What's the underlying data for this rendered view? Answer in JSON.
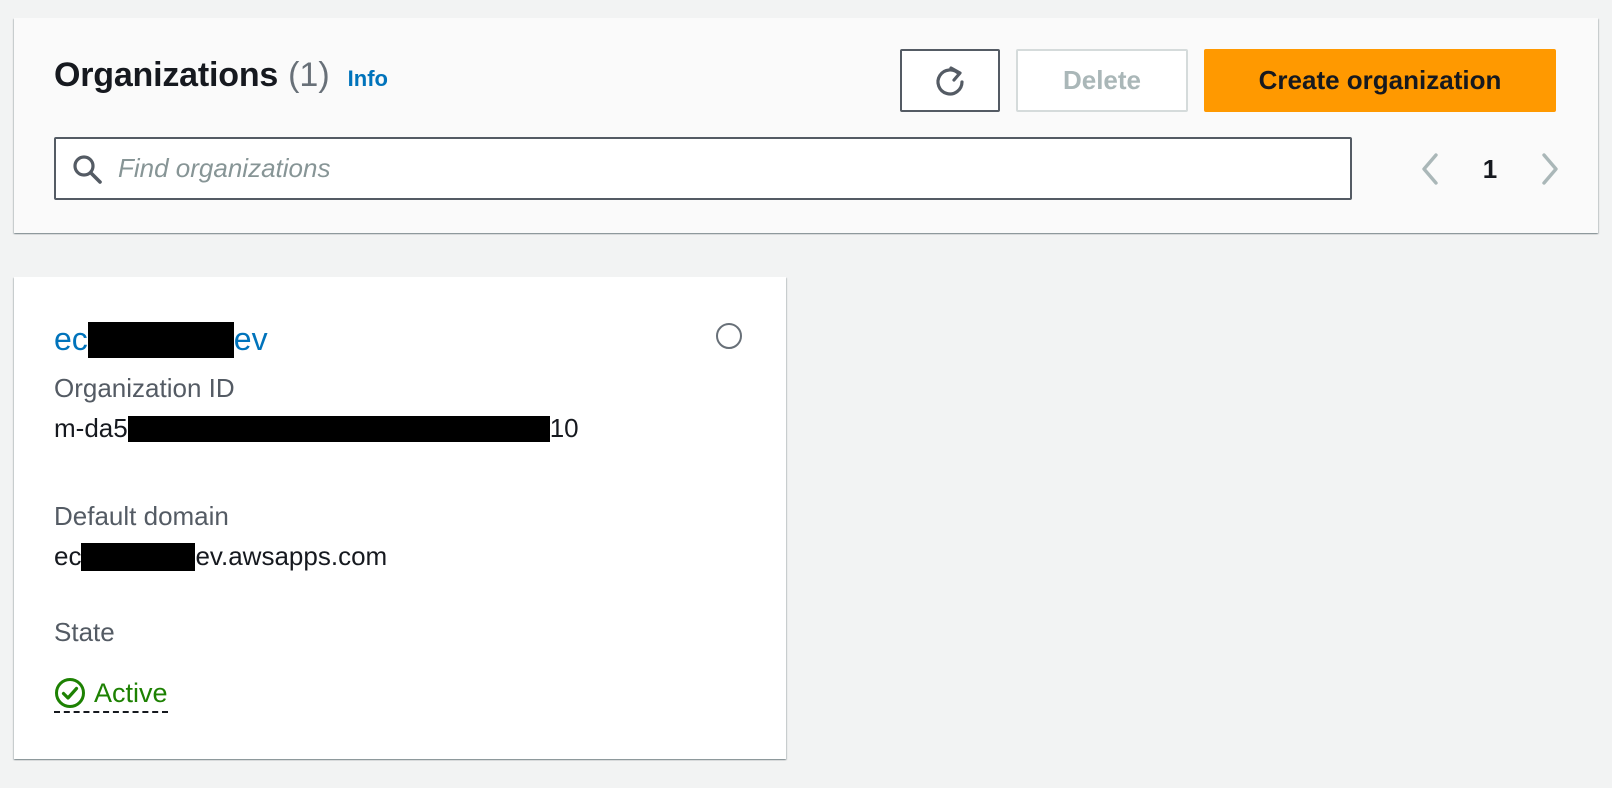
{
  "header": {
    "title": "Organizations",
    "count": "(1)",
    "info_label": "Info",
    "delete_label": "Delete",
    "create_label": "Create organization",
    "refresh_icon": "refresh-icon"
  },
  "search": {
    "placeholder": "Find organizations",
    "value": ""
  },
  "pagination": {
    "current_page": "1",
    "prev_icon": "chevron-left-icon",
    "next_icon": "chevron-right-icon"
  },
  "organization": {
    "name_prefix": "ec",
    "name_suffix": "ev",
    "id_label": "Organization ID",
    "id_prefix": "m-da5",
    "id_suffix": "10",
    "domain_label": "Default domain",
    "domain_prefix": "ec",
    "domain_suffix": "ev.awsapps.com",
    "state_label": "State",
    "state_value": "Active"
  },
  "colors": {
    "primary": "#ff9900",
    "link": "#0073bb",
    "success": "#1d8102",
    "background": "#f2f3f3"
  }
}
